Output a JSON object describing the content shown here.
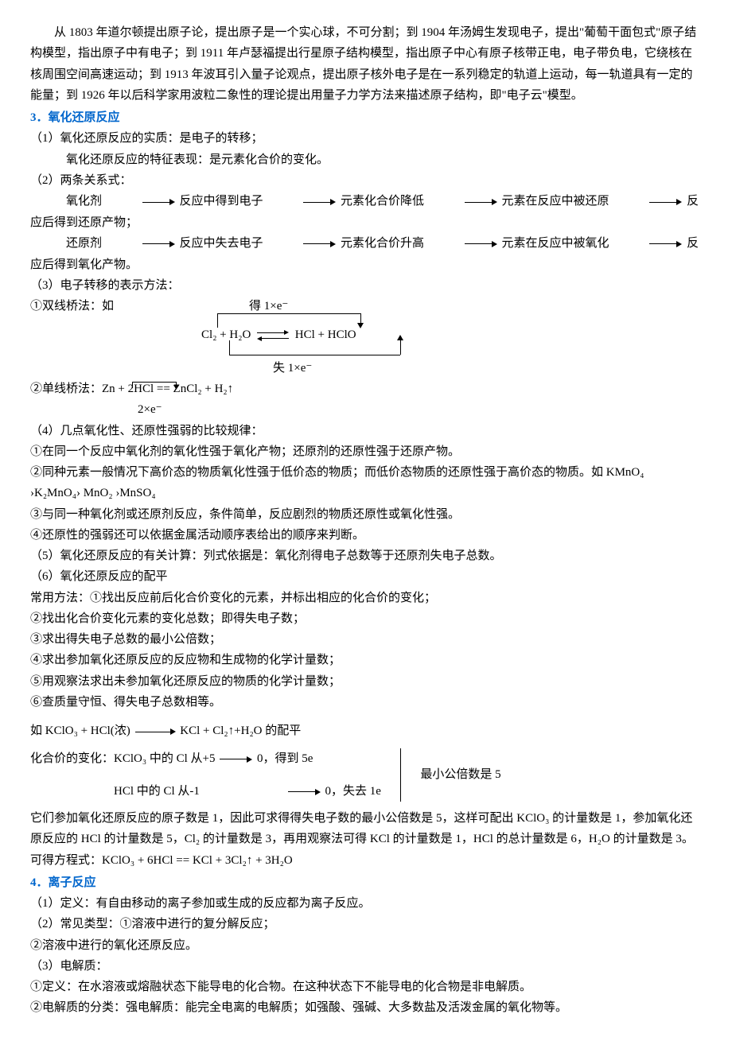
{
  "intro": "从 1803 年道尔顿提出原子论，提出原子是一个实心球，不可分割；到 1904 年汤姆生发现电子，提出\"葡萄干面包式\"原子结构模型，指出原子中有电子；到 1911 年卢瑟福提出行星原子结构模型，指出原子中心有原子核带正电，电子带负电，它绕核在核周围空间高速运动；到 1913 年波耳引入量子论观点，提出原子核外电子是在一系列稳定的轨道上运动，每一轨道具有一定的能量；到 1926 年以后科学家用波粒二象性的理论提出用量子力学方法来描述原子结构，即\"电子云\"模型。",
  "s3": {
    "title": "3．氧化还原反应",
    "p1": "（1）氧化还原反应的实质：是电子的转移；",
    "p1b": "氧化还原反应的特征表现：是元素化合价的变化。",
    "p2": "（2）两条关系式：",
    "row_ox": [
      "氧化剂",
      "反应中得到电子",
      "元素化合价降低",
      "元素在反应中被还原",
      "反应后得到还原产物；"
    ],
    "row_red": [
      "还原剂",
      "反应中失去电子",
      "元素化合价升高",
      "元素在反应中被氧化",
      "反应后得到氧化产物。"
    ],
    "p3": "（3）电子转移的表示方法：",
    "dbl_label": "①双线桥法：如",
    "dbl_top": "得 1×e⁻",
    "dbl_eq_l": "Cl₂ + H₂O",
    "dbl_eq_r": "HCl + HClO",
    "dbl_bot": "失 1×e⁻",
    "sgl_label": "②单线桥法：Zn + 2HCl == ZnCl₂ + H₂↑",
    "sgl_note": "2×e⁻",
    "p4": "（4）几点氧化性、还原性强弱的比较规律：",
    "c1": "①在同一个反应中氧化剂的氧化性强于氧化产物；还原剂的还原性强于还原产物。",
    "c2a": "②同种元素一般情况下高价态的物质氧化性强于低价态的物质；而低价态物质的还原性强于高价态的物质。如 KMnO₄",
    "c2b": "›K₂MnO₄› MnO₂ ›MnSO₄",
    "c3": "③与同一种氧化剂或还原剂反应，条件简单，反应剧烈的物质还原性或氧化性强。",
    "c4": "④还原性的强弱还可以依据金属活动顺序表给出的顺序来判断。",
    "p5": "（5）氧化还原反应的有关计算：列式依据是：氧化剂得电子总数等于还原剂失电子总数。",
    "p6": "（6）氧化还原反应的配平",
    "m0": "常用方法：①找出反应前后化合价变化的元素，并标出相应的化合价的变化；",
    "m2": "②找出化合价变化元素的变化总数；即得失电子数；",
    "m3": "③求出得失电子总数的最小公倍数；",
    "m4": "④求出参加氧化还原反应的反应物和生成物的化学计量数；",
    "m5": "⑤用观察法求出未参加氧化还原反应的物质的化学计量数；",
    "m6": "⑥查质量守恒、得失电子总数相等。",
    "ex1a": "如 KClO₃ + HCl(浓)",
    "ex1b": "KCl + Cl₂↑+H₂O 的配平",
    "ex2a": "化合价的变化：KClO₃ 中的 Cl 从+5",
    "ex2b": "0，得到 5e",
    "ex2r": "最小公倍数是 5",
    "ex3a": "HCl 中的 Cl 从-1",
    "ex3b": "0，失去 1e",
    "exp": "它们参加氧化还原反应的原子数是 1，因此可求得得失电子数的最小公倍数是 5，这样可配出 KClO₃ 的计量数是 1，参加氧化还原反应的 HCl 的计量数是 5，Cl₂ 的计量数是 3，再用观察法可得 KCl 的计量数是 1，HCl 的总计量数是 6，H₂O 的计量数是 3。",
    "final": "可得方程式：KClO₃ + 6HCl == KCl + 3Cl₂↑ + 3H₂O"
  },
  "s4": {
    "title": "4．离子反应",
    "d1": "（1）定义：有自由移动的离子参加或生成的反应都为离子反应。",
    "d2": "（2）常见类型：①溶液中进行的复分解反应；",
    "d2b": "②溶液中进行的氧化还原反应。",
    "d3": "（3）电解质：",
    "e1": "①定义：在水溶液或熔融状态下能导电的化合物。在这种状态下不能导电的化合物是非电解质。",
    "e2": "②电解质的分类：强电解质：能完全电离的电解质；如强酸、强碱、大多数盐及活泼金属的氧化物等。"
  }
}
